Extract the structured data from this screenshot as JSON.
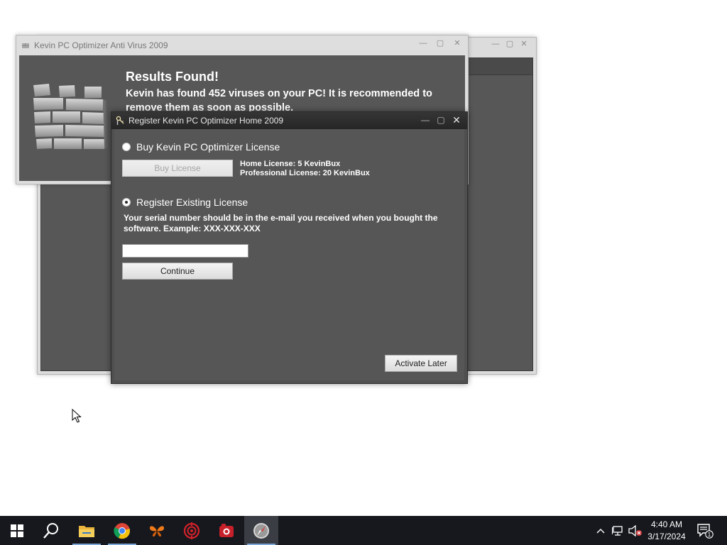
{
  "results_window": {
    "title": "Kevin PC Optimizer Anti Virus 2009",
    "heading": "Results Found!",
    "message": "Kevin has found 452 viruses on your PC! It is recommended to remove them as soon as possible."
  },
  "register_dialog": {
    "title": "Register Kevin PC Optimizer Home 2009",
    "buy_option_label": "Buy Kevin PC Optimizer License",
    "buy_button_label": "Buy License",
    "home_license_text": "Home License: 5 KevinBux",
    "pro_license_text": "Professional License: 20 KevinBux",
    "register_option_label": "Register Existing License",
    "serial_info": "Your serial number should be in the e-mail you received when you bought the software. Example: XXX-XXX-XXX",
    "serial_value": "",
    "continue_label": "Continue",
    "activate_later_label": "Activate Later",
    "selected_option": "register"
  },
  "taskbar": {
    "apps": [
      "start-icon",
      "search-icon",
      "file-explorer-icon",
      "chrome-icon",
      "butterfly-app-icon",
      "target-app-icon",
      "recorder-app-icon",
      "safari-compass-icon"
    ],
    "time": "4:40 AM",
    "date": "3/17/2024",
    "notification_count": "1"
  },
  "colors": {
    "dialog_background": "#565656",
    "taskbar": "#16181d",
    "running_indicator": "#7aa7d6"
  }
}
